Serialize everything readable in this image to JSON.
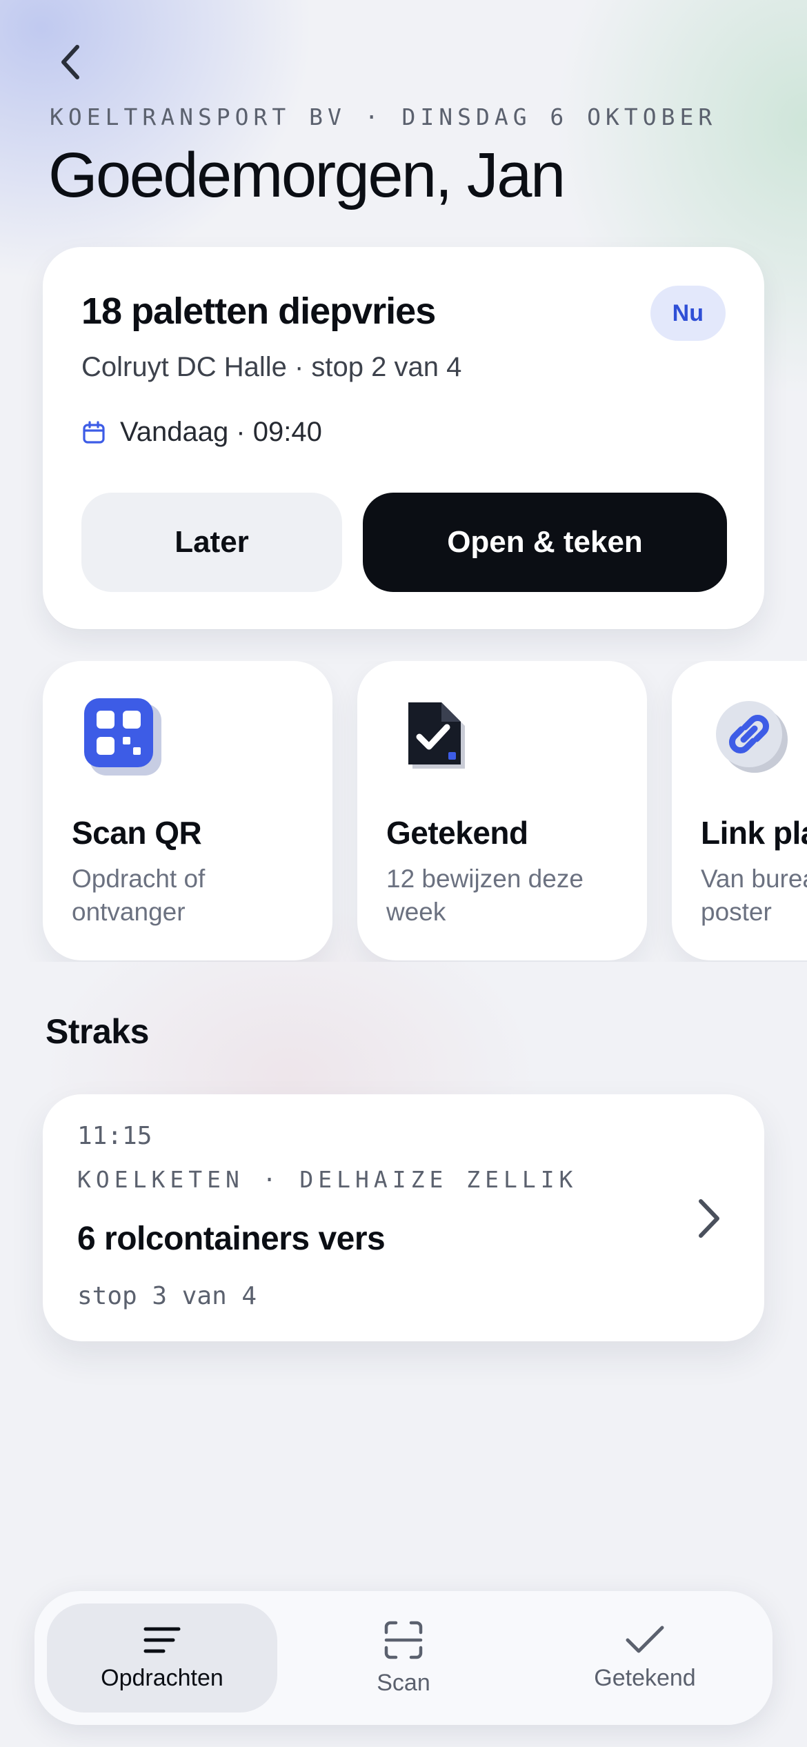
{
  "header": {
    "eyebrow": "KOELTRANSPORT BV · DINSDAG 6 OKTOBER",
    "greeting": "Goedemorgen, Jan"
  },
  "current_job": {
    "title": "18 paletten diepvries",
    "badge": "Nu",
    "subtitle": "Colruyt DC Halle · stop 2 van 4",
    "when": "Vandaag · 09:40",
    "later_label": "Later",
    "open_label": "Open & teken"
  },
  "tiles": [
    {
      "title": "Scan QR",
      "subtitle": "Opdracht of ontvanger",
      "icon": "qr-icon"
    },
    {
      "title": "Getekend",
      "subtitle": "12 bewijzen deze week",
      "icon": "signed-document-icon"
    },
    {
      "title": "Link plaatsen",
      "subtitle": "Van bureau of poster",
      "icon": "link-icon"
    }
  ],
  "section": {
    "title": "Straks"
  },
  "upcoming": {
    "time": "11:15",
    "meta": "KOELKETEN · DELHAIZE ZELLIK",
    "title": "6 rolcontainers vers",
    "stop": "stop 3 van 4"
  },
  "tabbar": {
    "tabs": [
      {
        "label": "Opdrachten",
        "icon": "list-icon",
        "active": true
      },
      {
        "label": "Scan",
        "icon": "scan-icon",
        "active": false
      },
      {
        "label": "Getekend",
        "icon": "check-icon",
        "active": false
      }
    ]
  },
  "colors": {
    "accent": "#3d5ce6",
    "badge_bg": "#e3e8fb",
    "primary_button": "#0b0e14"
  }
}
